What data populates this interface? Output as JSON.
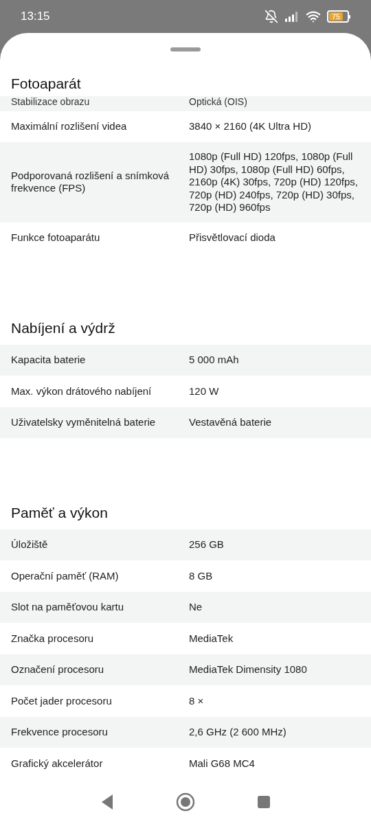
{
  "status_bar": {
    "time": "13:15",
    "battery": "75"
  },
  "sections": [
    {
      "title": "Fotoaparát",
      "rows": [
        {
          "label": "Stabilizace obrazu",
          "value": "Optická (OIS)",
          "partial": true
        },
        {
          "label": "Maximální rozlišení videa",
          "value": "3840 × 2160 (4K Ultra HD)"
        },
        {
          "label": "Podporovaná rozlišení a snímková frekvence (FPS)",
          "value": "1080p (Full HD) 120fps, 1080p (Full HD) 30fps, 1080p (Full HD) 60fps, 2160p (4K) 30fps, 720p (HD) 120fps, 720p (HD) 240fps, 720p (HD) 30fps, 720p (HD) 960fps"
        },
        {
          "label": "Funkce fotoaparátu",
          "value": "Přisvětlovací dioda"
        }
      ]
    },
    {
      "title": "Nabíjení a výdrž",
      "rows": [
        {
          "label": "Kapacita baterie",
          "value": "5 000 mAh"
        },
        {
          "label": "Max. výkon drátového nabíjení",
          "value": "120 W"
        },
        {
          "label": "Uživatelsky vyměnitelná baterie",
          "value": "Vestavěná baterie"
        }
      ]
    },
    {
      "title": "Paměť a výkon",
      "rows": [
        {
          "label": "Úložiště",
          "value": "256 GB"
        },
        {
          "label": "Operační paměť (RAM)",
          "value": "8 GB"
        },
        {
          "label": "Slot na paměťovou kartu",
          "value": "Ne"
        },
        {
          "label": "Značka procesoru",
          "value": "MediaTek"
        },
        {
          "label": "Označení procesoru",
          "value": "MediaTek Dimensity 1080"
        },
        {
          "label": "Počet jader procesoru",
          "value": "8 ×"
        },
        {
          "label": "Frekvence procesoru",
          "value": "2,6 GHz (2 600 MHz)"
        },
        {
          "label": "Grafický akcelerátor",
          "value": "Mali G68 MC4"
        }
      ]
    }
  ]
}
